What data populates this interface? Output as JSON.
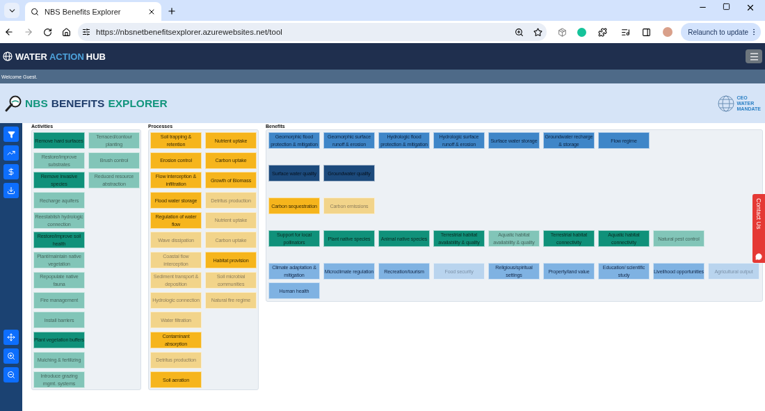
{
  "browser": {
    "tab_title": "NBS Benefits Explorer",
    "url": "https://nbsnetbenefitsexplorer.azurewebsites.net/tool",
    "update_button": "Relaunch to update"
  },
  "header": {
    "logo": [
      "WATER",
      "ACTION",
      "HUB"
    ],
    "welcome": "Welcome Guest."
  },
  "title": {
    "parts": [
      "NBS",
      "BENEFITS",
      "EXPLORER"
    ],
    "partner_logo": [
      "CEO",
      "WATER",
      "MANDATE"
    ]
  },
  "contact_tab": "Contact Us",
  "activities": {
    "label": "Activities",
    "columns": [
      [
        {
          "label": "Remove hard surfaces",
          "active": true
        },
        {
          "label": "Restore/improve substrates",
          "active": false
        },
        {
          "label": "Remove invasive species",
          "active": true
        },
        {
          "label": "Recharge aquifers",
          "active": false
        },
        {
          "label": "Reestablish hydrologic connection",
          "active": false
        },
        {
          "label": "Restore/improve soil health",
          "active": true
        },
        {
          "label": "Plant/maintain native vegetation",
          "active": false
        },
        {
          "label": "Repopulate native fauna",
          "active": false
        },
        {
          "label": "Fire management",
          "active": false
        },
        {
          "label": "Install barriers",
          "active": false
        },
        {
          "label": "Plant vegetation buffers",
          "active": true
        },
        {
          "label": "Mulching & fertilizing",
          "active": false
        },
        {
          "label": "Introduce grazing mgmt. systems",
          "active": false
        }
      ],
      [
        {
          "label": "Terraced/contour planting",
          "active": false
        },
        {
          "label": "Brush control",
          "active": false
        },
        {
          "label": "Reduced resource abstraction",
          "active": false
        }
      ]
    ]
  },
  "processes": {
    "label": "Processes",
    "columns": [
      [
        {
          "label": "Soil trapping & retention",
          "active": true
        },
        {
          "label": "Erosion control",
          "active": true
        },
        {
          "label": "Flow interception & infiltration",
          "active": true
        },
        {
          "label": "Flood water storage",
          "active": true
        },
        {
          "label": "Regulation of water flow",
          "active": true
        },
        {
          "label": "Wave dissipation",
          "active": false
        },
        {
          "label": "Coastal flow interception",
          "active": false
        },
        {
          "label": "Sediment transport & deposition",
          "active": false
        },
        {
          "label": "Hydrologic connection",
          "active": false
        },
        {
          "label": "Water filtration",
          "active": false
        },
        {
          "label": "Contaminant absorption",
          "active": true
        },
        {
          "label": "Detritus production",
          "active": false
        },
        {
          "label": "Soil aeration",
          "active": true
        }
      ],
      [
        {
          "label": "Nutrient uptake",
          "active": true
        },
        {
          "label": "Carbon uptake",
          "active": true
        },
        {
          "label": "Growth of Biomass",
          "active": true
        },
        {
          "label": "Detritus production",
          "active": false
        },
        {
          "label": "Nutrient uptake",
          "active": false
        },
        {
          "label": "Carbon uptake",
          "active": false
        },
        {
          "label": "Habitat provision",
          "active": true
        },
        {
          "label": "Soil microbial communities",
          "active": false
        },
        {
          "label": "Natural fire regime",
          "active": false
        }
      ]
    ]
  },
  "benefits": {
    "label": "Benefits",
    "groups": [
      {
        "kind": "water-quantity",
        "items": [
          {
            "label": "Geomorphic flood protection & mitigation",
            "active": true
          },
          {
            "label": "Geomorphic surface runoff & erosion",
            "active": true
          },
          {
            "label": "Hydrologic flood protection & mitigation",
            "active": true
          },
          {
            "label": "Hydrologic surface runoff & erosion",
            "active": true
          },
          {
            "label": "Surface water storage",
            "active": true
          },
          {
            "label": "Groundwater recharge & storage",
            "active": true
          },
          {
            "label": "Flow regime",
            "active": true
          }
        ]
      },
      {
        "kind": "water-quality",
        "items": [
          {
            "label": "Surface water quality",
            "active": true
          },
          {
            "label": "Groundwater quality",
            "active": true
          }
        ]
      },
      {
        "kind": "carbon",
        "items": [
          {
            "label": "Carbon sequestration",
            "active": true
          },
          {
            "label": "Carbon emissions",
            "active": false
          }
        ]
      },
      {
        "kind": "habitat",
        "items": [
          {
            "label": "Support for local pollinators",
            "active": true
          },
          {
            "label": "Plant native species",
            "active": true
          },
          {
            "label": "Animal native species",
            "active": true
          },
          {
            "label": "Terrestrial habitat availability & quality",
            "active": true
          },
          {
            "label": "Aquatic habitat availability & quality",
            "active": false
          },
          {
            "label": "Terrestrial habitat connectivity",
            "active": true
          },
          {
            "label": "Aquatic habitat connectivity",
            "active": true
          },
          {
            "label": "Natural pest control",
            "active": false
          }
        ]
      },
      {
        "kind": "social",
        "items": [
          {
            "label": "Climate adaptation & mitigation",
            "active": true
          },
          {
            "label": "Microclimate regulation",
            "active": true
          },
          {
            "label": "Recreation/tourism",
            "active": true
          },
          {
            "label": "Food security",
            "active": false
          },
          {
            "label": "Religious/spiritual settings",
            "active": true
          },
          {
            "label": "Property/land value",
            "active": true
          },
          {
            "label": "Education/ scientific study",
            "active": true
          },
          {
            "label": "Livelihood opportunities",
            "active": true
          },
          {
            "label": "Agricultural output",
            "active": false
          },
          {
            "label": "Human health",
            "active": true
          }
        ]
      }
    ]
  }
}
